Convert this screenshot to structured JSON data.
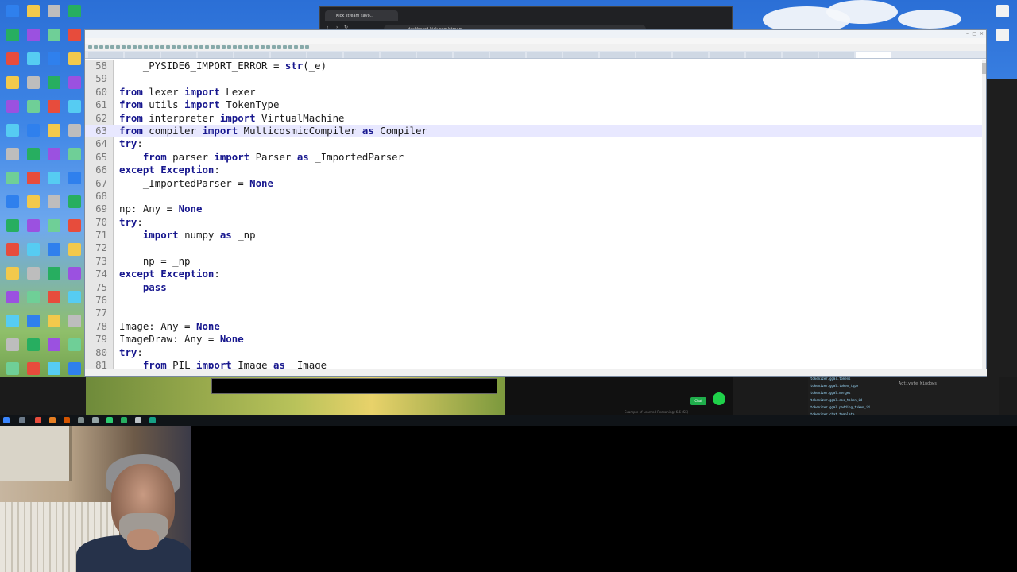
{
  "browser": {
    "tab_title": "Kick stream sayo...",
    "url": "dashboard.kick.com/stream"
  },
  "editor": {
    "lines": [
      {
        "n": "58",
        "tokens": [
          {
            "t": "    _PYSIDE6_IMPORT_ERROR = "
          },
          {
            "t": "str",
            "k": true
          },
          {
            "t": "(_e)"
          }
        ]
      },
      {
        "n": "59",
        "tokens": []
      },
      {
        "n": "60",
        "tokens": [
          {
            "t": "from",
            "k": true
          },
          {
            "t": " lexer "
          },
          {
            "t": "import",
            "k": true
          },
          {
            "t": " Lexer"
          }
        ]
      },
      {
        "n": "61",
        "tokens": [
          {
            "t": "from",
            "k": true
          },
          {
            "t": " utils "
          },
          {
            "t": "import",
            "k": true
          },
          {
            "t": " TokenType"
          }
        ]
      },
      {
        "n": "62",
        "tokens": [
          {
            "t": "from",
            "k": true
          },
          {
            "t": " interpreter "
          },
          {
            "t": "import",
            "k": true
          },
          {
            "t": " VirtualMachine"
          }
        ]
      },
      {
        "n": "63",
        "current": true,
        "tokens": [
          {
            "t": "from",
            "k": true
          },
          {
            "t": " compiler "
          },
          {
            "t": "import",
            "k": true
          },
          {
            "t": " MulticosmicCompiler "
          },
          {
            "t": "as",
            "k": true
          },
          {
            "t": " Compiler"
          }
        ]
      },
      {
        "n": "64",
        "tokens": [
          {
            "t": "try",
            "k": true
          },
          {
            "t": ":"
          }
        ]
      },
      {
        "n": "65",
        "tokens": [
          {
            "t": "    "
          },
          {
            "t": "from",
            "k": true
          },
          {
            "t": " parser "
          },
          {
            "t": "import",
            "k": true
          },
          {
            "t": " Parser "
          },
          {
            "t": "as",
            "k": true
          },
          {
            "t": " _ImportedParser"
          }
        ]
      },
      {
        "n": "66",
        "tokens": [
          {
            "t": "except",
            "k": true
          },
          {
            "t": " "
          },
          {
            "t": "Exception",
            "k": true
          },
          {
            "t": ":"
          }
        ]
      },
      {
        "n": "67",
        "tokens": [
          {
            "t": "    _ImportedParser = "
          },
          {
            "t": "None",
            "k": true
          }
        ]
      },
      {
        "n": "68",
        "tokens": []
      },
      {
        "n": "69",
        "tokens": [
          {
            "t": "np: Any = "
          },
          {
            "t": "None",
            "k": true
          }
        ]
      },
      {
        "n": "70",
        "tokens": [
          {
            "t": "try",
            "k": true
          },
          {
            "t": ":"
          }
        ]
      },
      {
        "n": "71",
        "tokens": [
          {
            "t": "    "
          },
          {
            "t": "import",
            "k": true
          },
          {
            "t": " numpy "
          },
          {
            "t": "as",
            "k": true
          },
          {
            "t": " _np"
          }
        ]
      },
      {
        "n": "72",
        "tokens": []
      },
      {
        "n": "73",
        "tokens": [
          {
            "t": "    np = _np"
          }
        ]
      },
      {
        "n": "74",
        "tokens": [
          {
            "t": "except",
            "k": true
          },
          {
            "t": " "
          },
          {
            "t": "Exception",
            "k": true
          },
          {
            "t": ":"
          }
        ]
      },
      {
        "n": "75",
        "tokens": [
          {
            "t": "    "
          },
          {
            "t": "pass",
            "k": true
          }
        ]
      },
      {
        "n": "76",
        "tokens": []
      },
      {
        "n": "77",
        "tokens": []
      },
      {
        "n": "78",
        "tokens": [
          {
            "t": "Image: Any = "
          },
          {
            "t": "None",
            "k": true
          }
        ]
      },
      {
        "n": "79",
        "tokens": [
          {
            "t": "ImageDraw: Any = "
          },
          {
            "t": "None",
            "k": true
          }
        ]
      },
      {
        "n": "80",
        "tokens": [
          {
            "t": "try",
            "k": true
          },
          {
            "t": ":"
          }
        ]
      },
      {
        "n": "81",
        "tokens": [
          {
            "t": "    "
          },
          {
            "t": "from",
            "k": true
          },
          {
            "t": " PIL "
          },
          {
            "t": "import",
            "k": true
          },
          {
            "t": " Image "
          },
          {
            "t": "as",
            "k": true
          },
          {
            "t": " _Image"
          }
        ]
      }
    ]
  },
  "player": {
    "chat_label": "Chat",
    "subtitle": "Example of Learned Reasoning: 6.6 (SE)"
  },
  "debug": {
    "rows": [
      {
        "k": "tokenizer.ggml.tokens",
        "v": ""
      },
      {
        "k": "tokenizer.ggml.token_type",
        "v": ""
      },
      {
        "k": "tokenizer.ggml.merges",
        "v": ""
      },
      {
        "k": "tokenizer.ggml.eos_token_id",
        "v": ""
      },
      {
        "k": "tokenizer.ggml.padding_token_id",
        "v": ""
      },
      {
        "k": "tokenizer.chat_template",
        "v": ""
      }
    ],
    "activate_windows": "Activate Windows"
  },
  "colors": {
    "keyword": "#17178e",
    "current_line": "#e8e8ff",
    "chat_green": "#1fae4b"
  }
}
